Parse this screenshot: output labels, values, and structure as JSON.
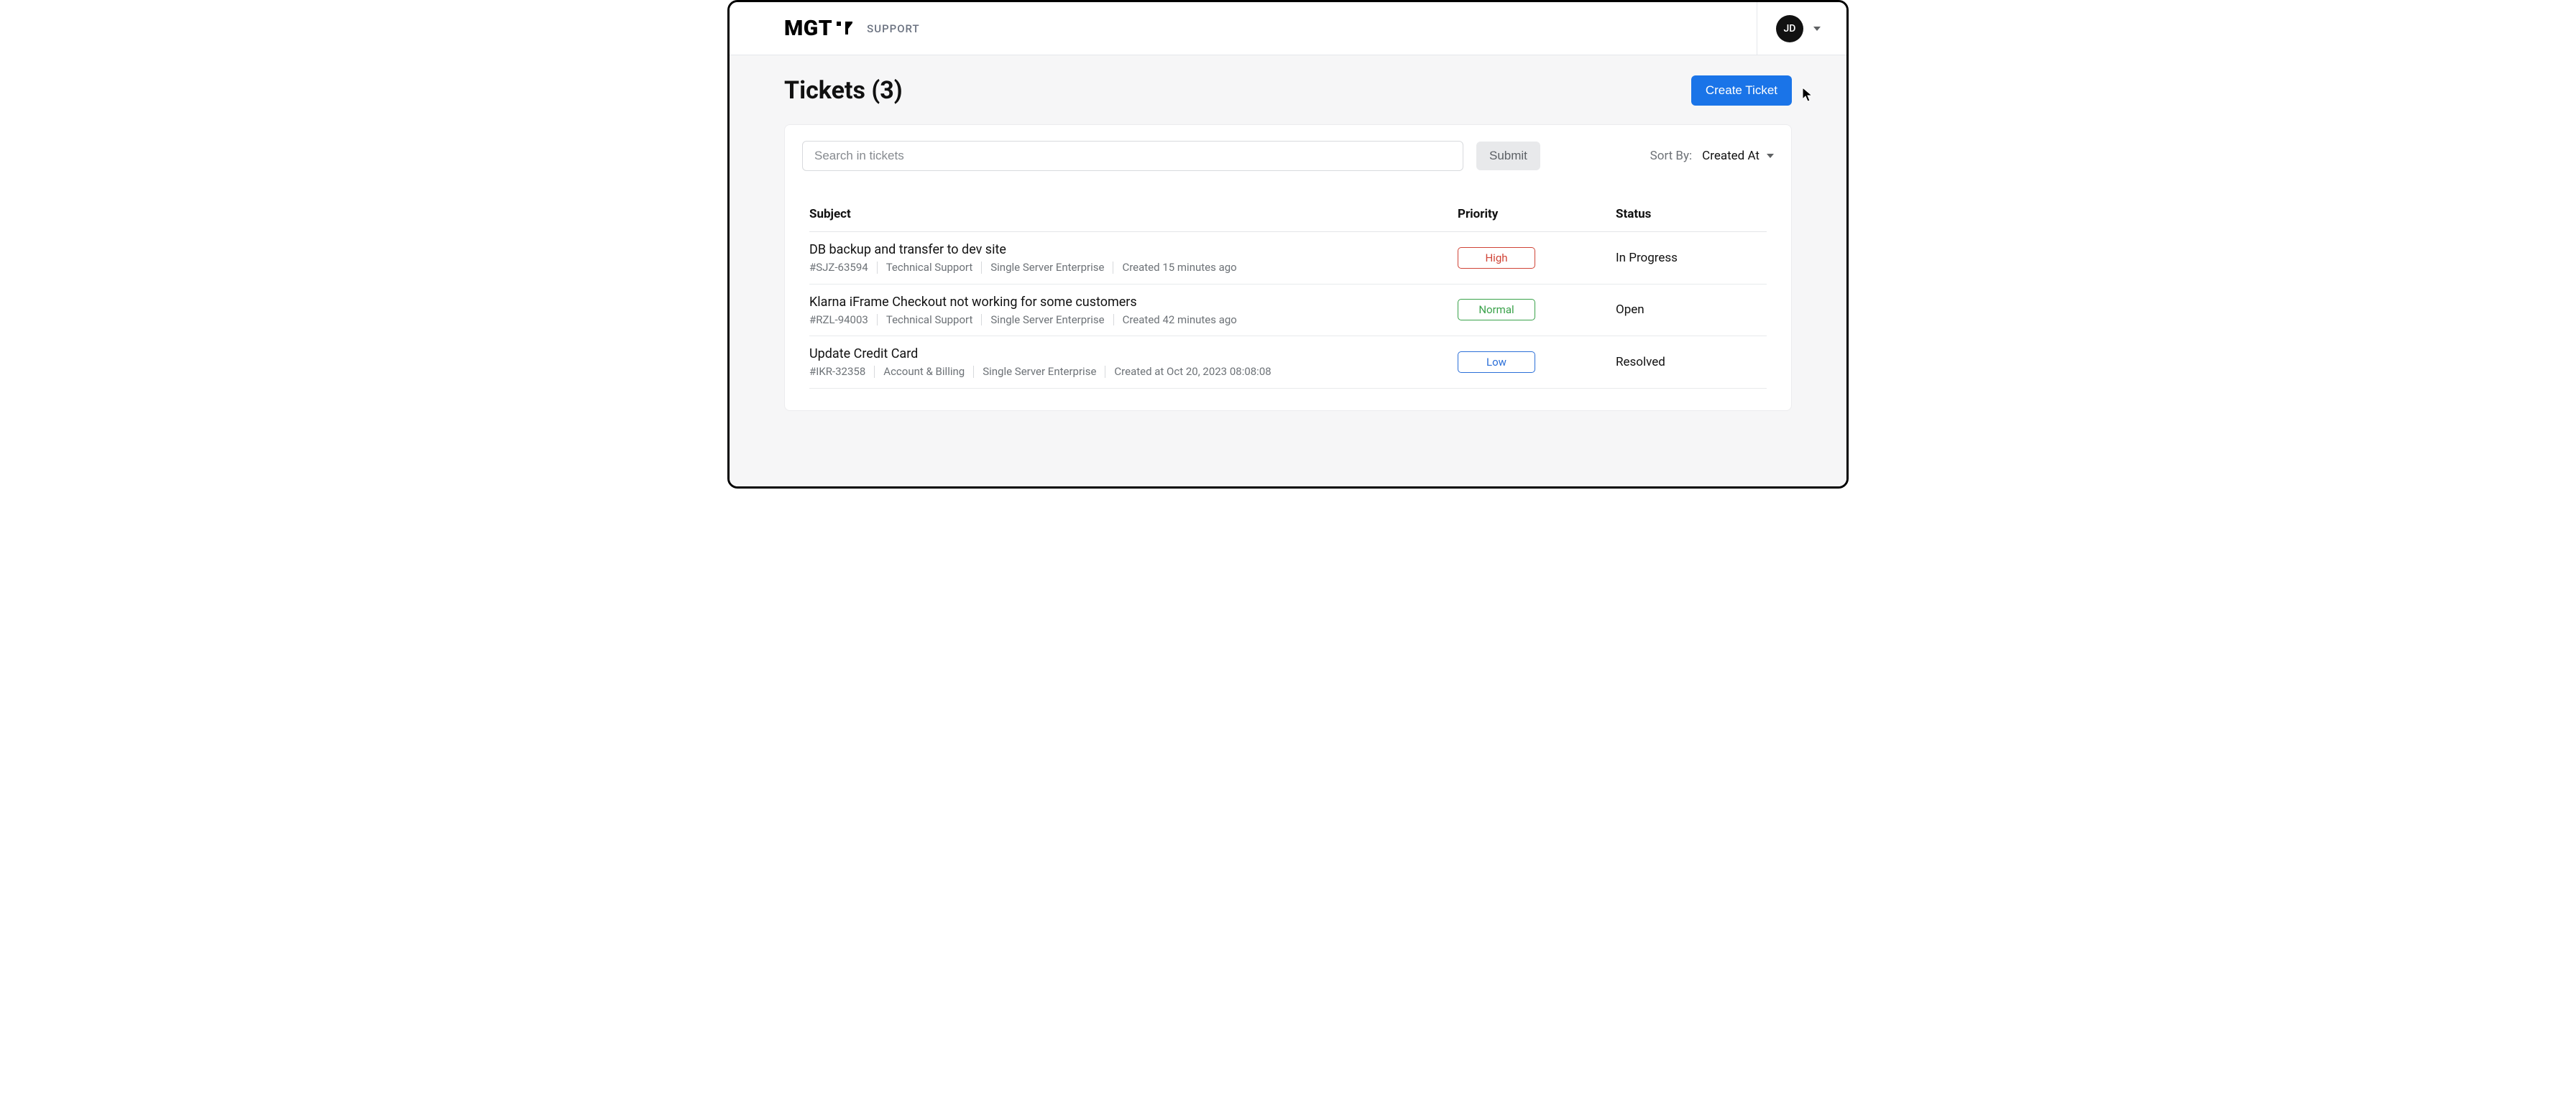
{
  "header": {
    "brand": "MGT",
    "brand_sub": "SUPPORT",
    "user_initials": "JD"
  },
  "page": {
    "title": "Tickets (3)",
    "create_button": "Create Ticket",
    "search_placeholder": "Search in tickets",
    "submit_button": "Submit",
    "sort_label": "Sort By:",
    "sort_selected": "Created At"
  },
  "table": {
    "columns": {
      "subject": "Subject",
      "priority": "Priority",
      "status": "Status"
    },
    "rows": [
      {
        "subject": "DB backup and transfer to dev site",
        "ticket_id": "#SJZ-63594",
        "category": "Technical Support",
        "plan": "Single Server Enterprise",
        "created": "Created 15 minutes ago",
        "priority": "High",
        "priority_class": "badge-high",
        "status": "In Progress"
      },
      {
        "subject": "Klarna iFrame Checkout not working for some customers",
        "ticket_id": "#RZL-94003",
        "category": "Technical Support",
        "plan": "Single Server Enterprise",
        "created": "Created 42 minutes ago",
        "priority": "Normal",
        "priority_class": "badge-normal",
        "status": "Open"
      },
      {
        "subject": "Update Credit Card",
        "ticket_id": "#IKR-32358",
        "category": "Account & Billing",
        "plan": "Single Server Enterprise",
        "created": "Created at Oct 20, 2023 08:08:08",
        "priority": "Low",
        "priority_class": "badge-low",
        "status": "Resolved"
      }
    ]
  }
}
